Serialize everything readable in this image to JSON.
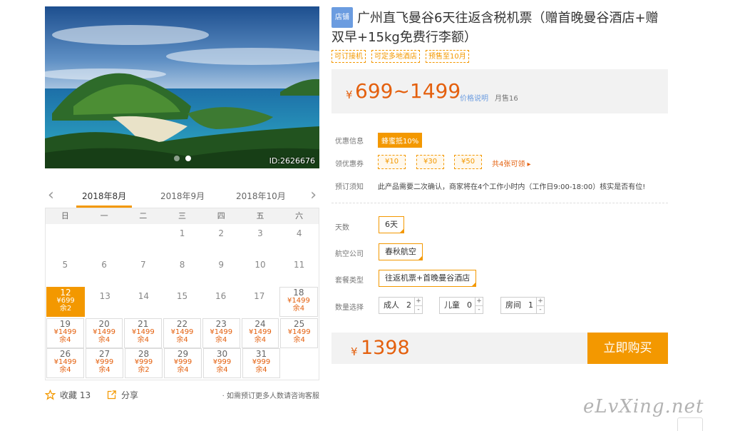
{
  "photo": {
    "id_label": "ID:2626676"
  },
  "calendar": {
    "prev": "‹",
    "next": "›",
    "months": [
      "2018年8月",
      "2018年9月",
      "2018年10月"
    ],
    "weekdays": [
      "日",
      "一",
      "二",
      "三",
      "四",
      "五",
      "六"
    ],
    "rows": [
      [
        {
          "d": ""
        },
        {
          "d": ""
        },
        {
          "d": ""
        },
        {
          "d": "1"
        },
        {
          "d": "2"
        },
        {
          "d": "3"
        },
        {
          "d": "4"
        }
      ],
      [
        {
          "d": "5"
        },
        {
          "d": "6"
        },
        {
          "d": "7"
        },
        {
          "d": "8"
        },
        {
          "d": "9"
        },
        {
          "d": "10"
        },
        {
          "d": "11"
        }
      ],
      [
        {
          "d": "12",
          "p": "¥699",
          "s": "余2",
          "sel": true
        },
        {
          "d": "13"
        },
        {
          "d": "14"
        },
        {
          "d": "15"
        },
        {
          "d": "16"
        },
        {
          "d": "17"
        },
        {
          "d": "18",
          "p": "¥1499",
          "s": "余4"
        }
      ],
      [
        {
          "d": "19",
          "p": "¥1499",
          "s": "余4"
        },
        {
          "d": "20",
          "p": "¥1499",
          "s": "余4"
        },
        {
          "d": "21",
          "p": "¥1499",
          "s": "余4"
        },
        {
          "d": "22",
          "p": "¥1499",
          "s": "余4"
        },
        {
          "d": "23",
          "p": "¥1499",
          "s": "余4"
        },
        {
          "d": "24",
          "p": "¥1499",
          "s": "余4"
        },
        {
          "d": "25",
          "p": "¥1499",
          "s": "余4"
        }
      ],
      [
        {
          "d": "26",
          "p": "¥1499",
          "s": "余4"
        },
        {
          "d": "27",
          "p": "¥999",
          "s": "余4"
        },
        {
          "d": "28",
          "p": "¥999",
          "s": "余2"
        },
        {
          "d": "29",
          "p": "¥999",
          "s": "余4"
        },
        {
          "d": "30",
          "p": "¥999",
          "s": "余4"
        },
        {
          "d": "31",
          "p": "¥999",
          "s": "余4"
        },
        {
          "d": ""
        }
      ]
    ]
  },
  "footer": {
    "favorite": "收藏 13",
    "share": "分享",
    "note": "· 如需预订更多人数请咨询客服"
  },
  "product": {
    "shop_tag": "店铺",
    "title": "广州直飞曼谷6天往返含税机票（赠首晚曼谷酒店+赠双早+15kg免费行李额）",
    "tags": [
      "可订接机",
      "可定多地酒店",
      "预售至10月"
    ],
    "currency": "¥",
    "price_range": "699~1499",
    "price_desc": "价格说明",
    "sold": "月售16"
  },
  "promo": {
    "promo_label": "优惠信息",
    "promo_badge": "蜂蜜抵10%",
    "coupon_label": "领优惠券",
    "coupons": [
      "¥10",
      "¥30",
      "¥50"
    ],
    "coupon_more": "共4张可领 ▸",
    "notice_label": "预订须知",
    "notice": "此产品需要二次确认，商家将在4个工作小时内（工作日9:00-18:00）核实是否有位!"
  },
  "options": {
    "days_label": "天数",
    "days": "6天",
    "airline_label": "航空公司",
    "airline": "春秋航空",
    "package_label": "套餐类型",
    "package": "往返机票+首晚曼谷酒店",
    "qty_label": "数量选择",
    "adult_label": "成人",
    "adult": "2",
    "child_label": "儿童",
    "child": "0",
    "room_label": "房间",
    "room": "1",
    "plus": "+",
    "minus": "-"
  },
  "purchase": {
    "currency": "¥",
    "total": "1398",
    "buy": "立即购买"
  },
  "watermark": "eLvXing.net",
  "colors": {
    "accent": "#f39800",
    "price": "#e4600e",
    "link": "#6b9ce0"
  }
}
